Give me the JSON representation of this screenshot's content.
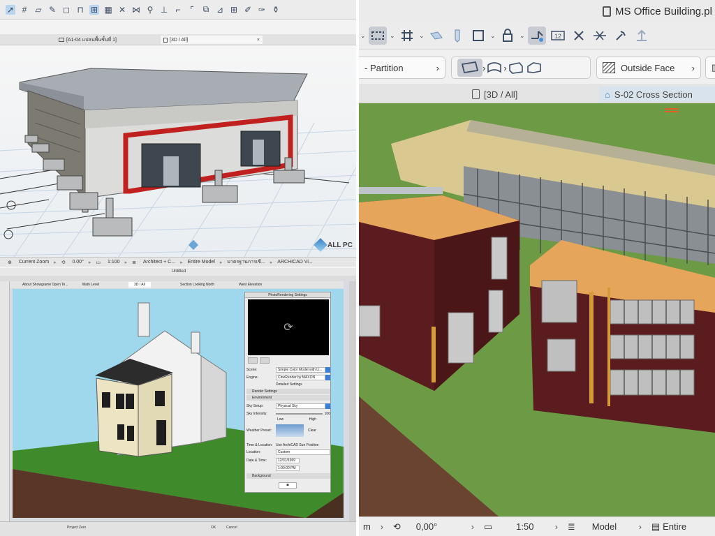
{
  "top_left": {
    "tabs": [
      {
        "label": "[A1-04 แปลนพื้นชั้นที่ 1]"
      },
      {
        "label": "[3D / All]"
      }
    ],
    "status": {
      "zoom_label": "Current Zoom",
      "angle": "0.00°",
      "scale": "1:100",
      "layer": "Architect + C...",
      "model": "Entire Model",
      "standard": "มาตรฐานการเขี...",
      "extra": "ARCHICAD Vi..."
    },
    "watermark": "ALL PC"
  },
  "bottom_left": {
    "window_title": "Untitled",
    "tabs": [
      {
        "label": "About Showgrame Open Te..."
      },
      {
        "label": "Main Level"
      },
      {
        "label": "3D / All"
      },
      {
        "label": "Section Looking North"
      },
      {
        "label": "West Elevation"
      }
    ],
    "render_panel": {
      "title": "PhotoRendering Settings",
      "scene_label": "Scene:",
      "scene_value": "Simple Color Model with Li...",
      "engine_label": "Engine:",
      "engine_value": "CineRender by MAXON",
      "detailed": "Detailed Settings",
      "render_settings": "Render Settings",
      "environment": "Environment",
      "sky_setup_label": "Sky Setup:",
      "sky_setup_value": "Physical Sky",
      "sky_intensity_label": "Sky Intensity:",
      "sky_intensity_value": "100",
      "low": "Low",
      "high": "High",
      "weather_label": "Weather Preset:",
      "weather_value": "Clear",
      "time_label": "Time & Location:",
      "use_sun": "Use ArchiCAD Sun Position",
      "location_label": "Location:",
      "location_value": "Custom",
      "date_label": "Date & Time:",
      "date_value": "12/31/1969",
      "time_value": "1:00:00 PM",
      "background": "Background"
    },
    "status": {
      "ok": "OK",
      "cancel": "Cancel",
      "project_zero": "Project Zero"
    }
  },
  "right": {
    "window_title": "MS Office Building.pl",
    "info": {
      "partition": "- Partition",
      "outside_face": "Outside Face"
    },
    "tabs": [
      {
        "label": "[3D / All]"
      },
      {
        "label": "S-02 Cross Section"
      }
    ],
    "status": {
      "layer": "m",
      "angle": "0,00°",
      "scale": "1:50",
      "model": "Model",
      "entire": "Entire"
    }
  },
  "colors": {
    "accent_select": "#b8d4ee",
    "toolbar_bg": "#ececec",
    "building_red": "#7b1a1e",
    "roof_tan": "#e0a256",
    "grass": "#6f9a44",
    "sky_blue": "#9fd8ec"
  }
}
